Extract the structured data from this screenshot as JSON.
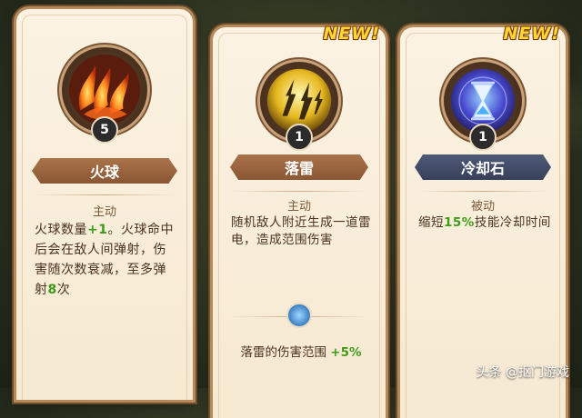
{
  "cards": [
    {
      "name": "火球",
      "level": "5",
      "type": "主动",
      "desc_parts": [
        "火球数量",
        "+1",
        "。火球命中后会在敌人间弹射，伤害随次数衰减，至多弹射",
        "8",
        "次"
      ],
      "icon": "fire-claw-icon"
    },
    {
      "name": "落雷",
      "level": "1",
      "type": "主动",
      "new": "NEW!",
      "desc": "随机敌人附近生成一道雷电，造成范围伤害",
      "bonus_label": "落雷的伤害范围",
      "bonus_value": "+5%",
      "icon": "lightning-icon"
    },
    {
      "name": "冷却石",
      "level": "1",
      "type": "被动",
      "new": "NEW!",
      "desc_parts": [
        "缩短",
        "15%",
        "技能冷却时间"
      ],
      "icon": "hourglass-icon"
    }
  ],
  "watermark": "头条 @抠门游戏",
  "colors": {
    "highlight": "#3f9a1a",
    "new_tag": "#ffd53a",
    "banner_brown": "#8a5734",
    "banner_blue": "#37405a"
  }
}
